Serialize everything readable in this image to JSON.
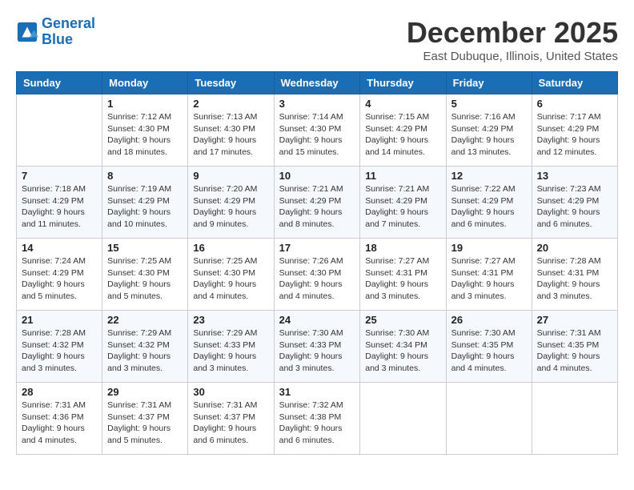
{
  "header": {
    "logo_line1": "General",
    "logo_line2": "Blue",
    "month_title": "December 2025",
    "location": "East Dubuque, Illinois, United States"
  },
  "weekdays": [
    "Sunday",
    "Monday",
    "Tuesday",
    "Wednesday",
    "Thursday",
    "Friday",
    "Saturday"
  ],
  "weeks": [
    [
      {
        "day": "",
        "info": ""
      },
      {
        "day": "1",
        "info": "Sunrise: 7:12 AM\nSunset: 4:30 PM\nDaylight: 9 hours\nand 18 minutes."
      },
      {
        "day": "2",
        "info": "Sunrise: 7:13 AM\nSunset: 4:30 PM\nDaylight: 9 hours\nand 17 minutes."
      },
      {
        "day": "3",
        "info": "Sunrise: 7:14 AM\nSunset: 4:30 PM\nDaylight: 9 hours\nand 15 minutes."
      },
      {
        "day": "4",
        "info": "Sunrise: 7:15 AM\nSunset: 4:29 PM\nDaylight: 9 hours\nand 14 minutes."
      },
      {
        "day": "5",
        "info": "Sunrise: 7:16 AM\nSunset: 4:29 PM\nDaylight: 9 hours\nand 13 minutes."
      },
      {
        "day": "6",
        "info": "Sunrise: 7:17 AM\nSunset: 4:29 PM\nDaylight: 9 hours\nand 12 minutes."
      }
    ],
    [
      {
        "day": "7",
        "info": "Sunrise: 7:18 AM\nSunset: 4:29 PM\nDaylight: 9 hours\nand 11 minutes."
      },
      {
        "day": "8",
        "info": "Sunrise: 7:19 AM\nSunset: 4:29 PM\nDaylight: 9 hours\nand 10 minutes."
      },
      {
        "day": "9",
        "info": "Sunrise: 7:20 AM\nSunset: 4:29 PM\nDaylight: 9 hours\nand 9 minutes."
      },
      {
        "day": "10",
        "info": "Sunrise: 7:21 AM\nSunset: 4:29 PM\nDaylight: 9 hours\nand 8 minutes."
      },
      {
        "day": "11",
        "info": "Sunrise: 7:21 AM\nSunset: 4:29 PM\nDaylight: 9 hours\nand 7 minutes."
      },
      {
        "day": "12",
        "info": "Sunrise: 7:22 AM\nSunset: 4:29 PM\nDaylight: 9 hours\nand 6 minutes."
      },
      {
        "day": "13",
        "info": "Sunrise: 7:23 AM\nSunset: 4:29 PM\nDaylight: 9 hours\nand 6 minutes."
      }
    ],
    [
      {
        "day": "14",
        "info": "Sunrise: 7:24 AM\nSunset: 4:29 PM\nDaylight: 9 hours\nand 5 minutes."
      },
      {
        "day": "15",
        "info": "Sunrise: 7:25 AM\nSunset: 4:30 PM\nDaylight: 9 hours\nand 5 minutes."
      },
      {
        "day": "16",
        "info": "Sunrise: 7:25 AM\nSunset: 4:30 PM\nDaylight: 9 hours\nand 4 minutes."
      },
      {
        "day": "17",
        "info": "Sunrise: 7:26 AM\nSunset: 4:30 PM\nDaylight: 9 hours\nand 4 minutes."
      },
      {
        "day": "18",
        "info": "Sunrise: 7:27 AM\nSunset: 4:31 PM\nDaylight: 9 hours\nand 3 minutes."
      },
      {
        "day": "19",
        "info": "Sunrise: 7:27 AM\nSunset: 4:31 PM\nDaylight: 9 hours\nand 3 minutes."
      },
      {
        "day": "20",
        "info": "Sunrise: 7:28 AM\nSunset: 4:31 PM\nDaylight: 9 hours\nand 3 minutes."
      }
    ],
    [
      {
        "day": "21",
        "info": "Sunrise: 7:28 AM\nSunset: 4:32 PM\nDaylight: 9 hours\nand 3 minutes."
      },
      {
        "day": "22",
        "info": "Sunrise: 7:29 AM\nSunset: 4:32 PM\nDaylight: 9 hours\nand 3 minutes."
      },
      {
        "day": "23",
        "info": "Sunrise: 7:29 AM\nSunset: 4:33 PM\nDaylight: 9 hours\nand 3 minutes."
      },
      {
        "day": "24",
        "info": "Sunrise: 7:30 AM\nSunset: 4:33 PM\nDaylight: 9 hours\nand 3 minutes."
      },
      {
        "day": "25",
        "info": "Sunrise: 7:30 AM\nSunset: 4:34 PM\nDaylight: 9 hours\nand 3 minutes."
      },
      {
        "day": "26",
        "info": "Sunrise: 7:30 AM\nSunset: 4:35 PM\nDaylight: 9 hours\nand 4 minutes."
      },
      {
        "day": "27",
        "info": "Sunrise: 7:31 AM\nSunset: 4:35 PM\nDaylight: 9 hours\nand 4 minutes."
      }
    ],
    [
      {
        "day": "28",
        "info": "Sunrise: 7:31 AM\nSunset: 4:36 PM\nDaylight: 9 hours\nand 4 minutes."
      },
      {
        "day": "29",
        "info": "Sunrise: 7:31 AM\nSunset: 4:37 PM\nDaylight: 9 hours\nand 5 minutes."
      },
      {
        "day": "30",
        "info": "Sunrise: 7:31 AM\nSunset: 4:37 PM\nDaylight: 9 hours\nand 6 minutes."
      },
      {
        "day": "31",
        "info": "Sunrise: 7:32 AM\nSunset: 4:38 PM\nDaylight: 9 hours\nand 6 minutes."
      },
      {
        "day": "",
        "info": ""
      },
      {
        "day": "",
        "info": ""
      },
      {
        "day": "",
        "info": ""
      }
    ]
  ]
}
